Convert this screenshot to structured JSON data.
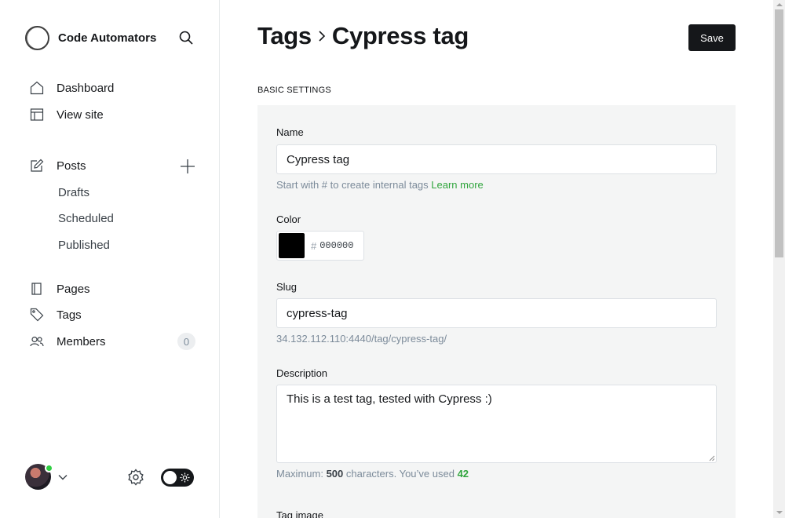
{
  "sidebar": {
    "site_name": "Code Automators",
    "nav": {
      "dashboard": "Dashboard",
      "view_site": "View site",
      "posts": "Posts",
      "drafts": "Drafts",
      "scheduled": "Scheduled",
      "published": "Published",
      "pages": "Pages",
      "tags": "Tags",
      "members": "Members",
      "members_count": "0"
    }
  },
  "header": {
    "breadcrumb_parent": "Tags",
    "breadcrumb_current": "Cypress tag",
    "save_label": "Save"
  },
  "form": {
    "section_title": "BASIC SETTINGS",
    "name_label": "Name",
    "name_value": "Cypress tag",
    "name_hint": "Start with # to create internal tags",
    "learn_more": "Learn more",
    "color_label": "Color",
    "color_hash": "#",
    "color_value": "000000",
    "slug_label": "Slug",
    "slug_value": "cypress-tag",
    "slug_url": "34.132.112.110:4440/tag/cypress-tag/",
    "description_label": "Description",
    "description_value": "This is a test tag, tested with Cypress :)",
    "desc_hint_prefix": "Maximum:",
    "desc_max": "500",
    "desc_hint_mid": "characters. You’ve used",
    "desc_used": "42",
    "tag_image_label": "Tag image"
  },
  "colors": {
    "accent_green": "#30a53d",
    "online_green": "#30cf43",
    "primary_dark": "#15171a",
    "panel_bg": "#f4f5f5",
    "swatch": "#000000"
  }
}
